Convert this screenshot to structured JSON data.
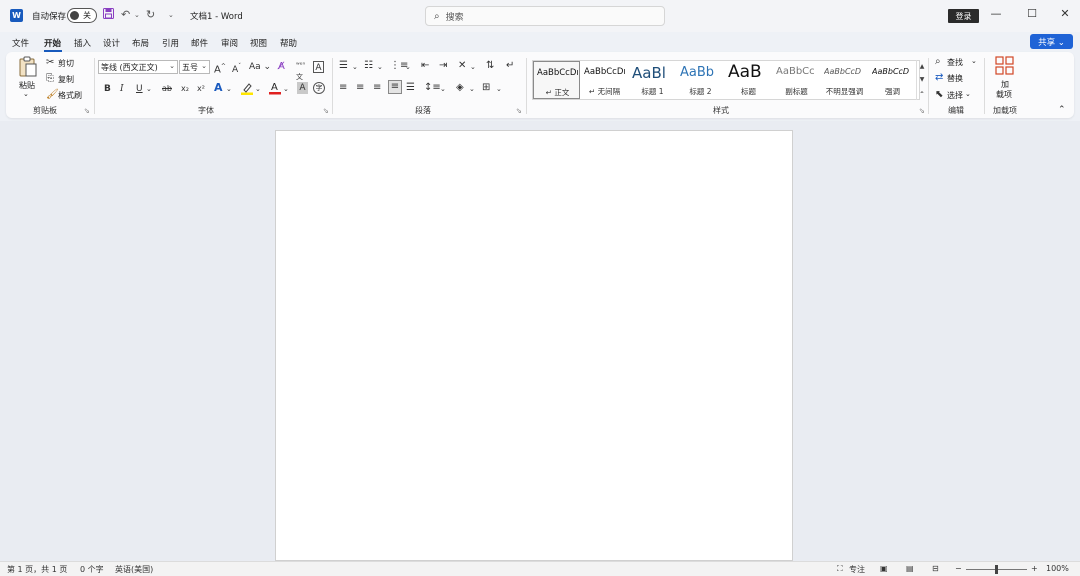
{
  "titlebar": {
    "app_icon": "word-icon",
    "app_letter": "W",
    "autosave_label": "自动保存",
    "autosave_state": "关",
    "save_icon": "save-icon",
    "undo_icon": "undo-icon",
    "redo_icon": "redo-icon",
    "customize_icon": "customize-qat-icon",
    "doc_title": "文档1  -  Word",
    "search_placeholder": "搜索",
    "signin_label": "登录",
    "minimize_glyph": "—",
    "maximize_glyph": "☐",
    "close_glyph": "✕"
  },
  "tabs": [
    "文件",
    "开始",
    "插入",
    "设计",
    "布局",
    "引用",
    "邮件",
    "审阅",
    "视图",
    "帮助"
  ],
  "active_tab": "开始",
  "share_label": "共享 ⌄",
  "ribbon": {
    "clipboard": {
      "paste_label": "粘贴",
      "cut_label": "剪切",
      "copy_label": "复制",
      "format_painter_label": "格式刷",
      "group_label": "剪贴板"
    },
    "font": {
      "font_name": "等线 (西文正文)",
      "font_size": "五号",
      "grow": "A",
      "shrink": "A",
      "case": "Aa",
      "bold": "B",
      "italic": "I",
      "underline": "U",
      "strike": "ab",
      "subscript": "x₂",
      "superscript": "x²",
      "group_label": "字体"
    },
    "paragraph": {
      "group_label": "段落"
    },
    "styles": {
      "items": [
        {
          "sample": "AaBbCcDı",
          "name": "↵ 正文"
        },
        {
          "sample": "AaBbCcDı",
          "name": "↵ 无间隔"
        },
        {
          "sample": "AaBl",
          "name": "标题 1"
        },
        {
          "sample": "AaBb",
          "name": "标题 2"
        },
        {
          "sample": "AaB",
          "name": "标题"
        },
        {
          "sample": "AaBbCc",
          "name": "副标题"
        },
        {
          "sample": "AaBbCcD",
          "name": "不明显强调"
        },
        {
          "sample": "AaBbCcD",
          "name": "强调"
        }
      ],
      "group_label": "样式"
    },
    "editing": {
      "find_label": "查找",
      "replace_label": "替换",
      "select_label": "选择",
      "group_label": "编辑"
    },
    "addins": {
      "label_line1": "加",
      "label_line2": "载项",
      "group_label": "加载项"
    }
  },
  "statusbar": {
    "page_info": "第 1 页，共 1 页",
    "word_count": "0 个字",
    "language": "英语(美国)",
    "focus_label": "专注",
    "zoom_level": "100%",
    "zoom_minus": "−",
    "zoom_plus": "+"
  },
  "colors": {
    "accent": "#185abd",
    "share_button": "#1f63d6",
    "highlight": "#ffe600",
    "font_color": "#e02020"
  }
}
